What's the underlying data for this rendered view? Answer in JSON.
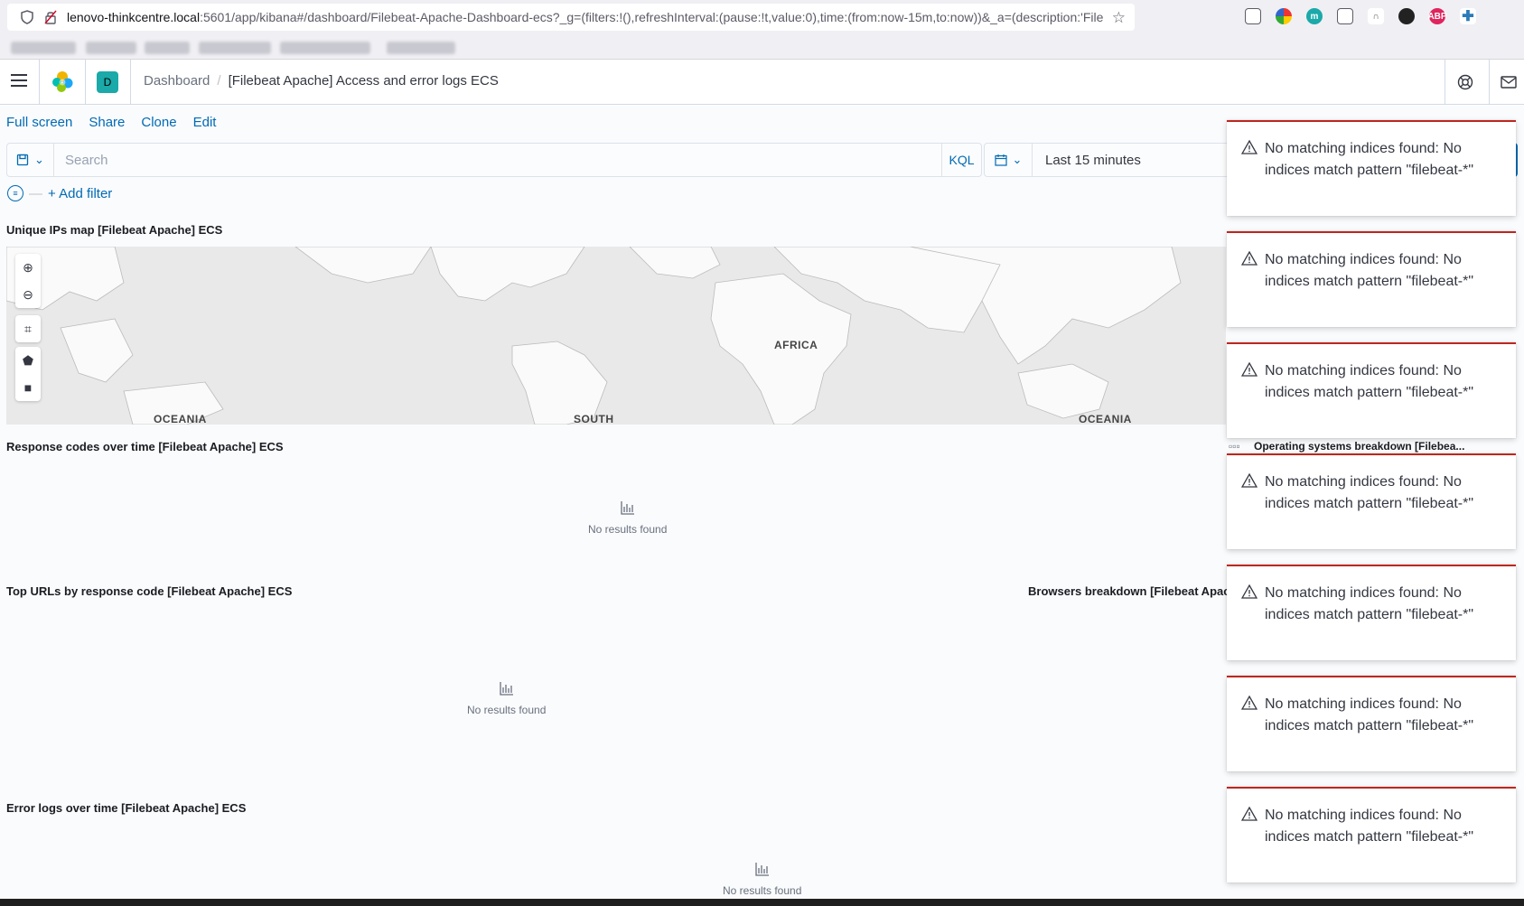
{
  "browser": {
    "url_host": "lenovo-thinkcentre.local",
    "url_rest": ":5601/app/kibana#/dashboard/Filebeat-Apache-Dashboard-ecs?_g=(filters:!(),refreshInterval:(pause:!t,value:0),time:(from:now-15m,to:now))&_a=(description:'Filebe"
  },
  "header": {
    "space_initial": "D",
    "breadcrumb_parent": "Dashboard",
    "breadcrumb_separator": "/",
    "breadcrumb_current": "[Filebeat Apache] Access and error logs ECS"
  },
  "top_menu": {
    "full_screen": "Full screen",
    "share": "Share",
    "clone": "Clone",
    "edit": "Edit"
  },
  "query": {
    "placeholder": "Search",
    "language": "KQL",
    "time_range": "Last 15 minutes"
  },
  "filters": {
    "add_filter": "+ Add filter"
  },
  "panels": {
    "map_title": "Unique IPs map [Filebeat Apache] ECS",
    "map_labels": [
      "AFRICA",
      "OCEANIA",
      "SOUTH",
      "OCEANIA"
    ],
    "response_codes_title": "Response codes over time [Filebeat Apache] ECS",
    "top_urls_title": "Top URLs by response code [Filebeat Apache] ECS",
    "browsers_title": "Browsers breakdown [Filebeat Apache",
    "error_logs_title": "Error logs over time [Filebeat Apache] ECS",
    "os_title": "Operating systems breakdown [Filebea...",
    "no_results": "No results found"
  },
  "toasts": [
    {
      "message": "No matching indices found: No indices match pattern \"filebeat-*\""
    },
    {
      "message": "No matching indices found: No indices match pattern \"filebeat-*\""
    },
    {
      "message": "No matching indices found: No indices match pattern \"filebeat-*\""
    },
    {
      "message": "No matching indices found: No indices match pattern \"filebeat-*\""
    },
    {
      "message": "No matching indices found: No indices match pattern \"filebeat-*\""
    },
    {
      "message": "No matching indices found: No indices match pattern \"filebeat-*\""
    },
    {
      "message": "No matching indices found: No indices match pattern \"filebeat-*\""
    }
  ],
  "colors": {
    "link": "#006bb4",
    "danger": "#bd271e",
    "space_badge": "#1ba9a9"
  }
}
